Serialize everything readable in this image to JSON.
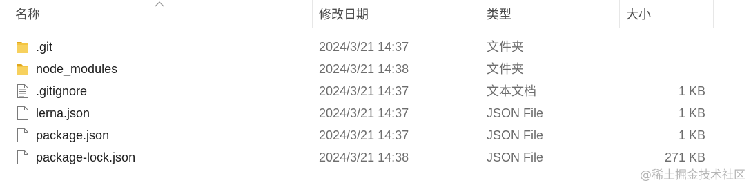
{
  "header": {
    "name_label": "名称",
    "date_label": "修改日期",
    "type_label": "类型",
    "size_label": "大小"
  },
  "files": [
    {
      "name": ".git",
      "date": "2024/3/21 14:37",
      "type": "文件夹",
      "size": "",
      "icon": "folder-icon"
    },
    {
      "name": "node_modules",
      "date": "2024/3/21 14:38",
      "type": "文件夹",
      "size": "",
      "icon": "folder-icon"
    },
    {
      "name": ".gitignore",
      "date": "2024/3/21 14:37",
      "type": "文本文档",
      "size": "1 KB",
      "icon": "text-document-icon"
    },
    {
      "name": "lerna.json",
      "date": "2024/3/21 14:37",
      "type": "JSON File",
      "size": "1 KB",
      "icon": "file-icon"
    },
    {
      "name": "package.json",
      "date": "2024/3/21 14:37",
      "type": "JSON File",
      "size": "1 KB",
      "icon": "file-icon"
    },
    {
      "name": "package-lock.json",
      "date": "2024/3/21 14:38",
      "type": "JSON File",
      "size": "271 KB",
      "icon": "file-icon"
    }
  ],
  "watermark": "@稀土掘金技术社区",
  "colors": {
    "folder": "#f4c542",
    "folder_dark": "#e0a81e",
    "header_text": "#4b4b4b",
    "secondary_text": "#6d6d6d"
  }
}
